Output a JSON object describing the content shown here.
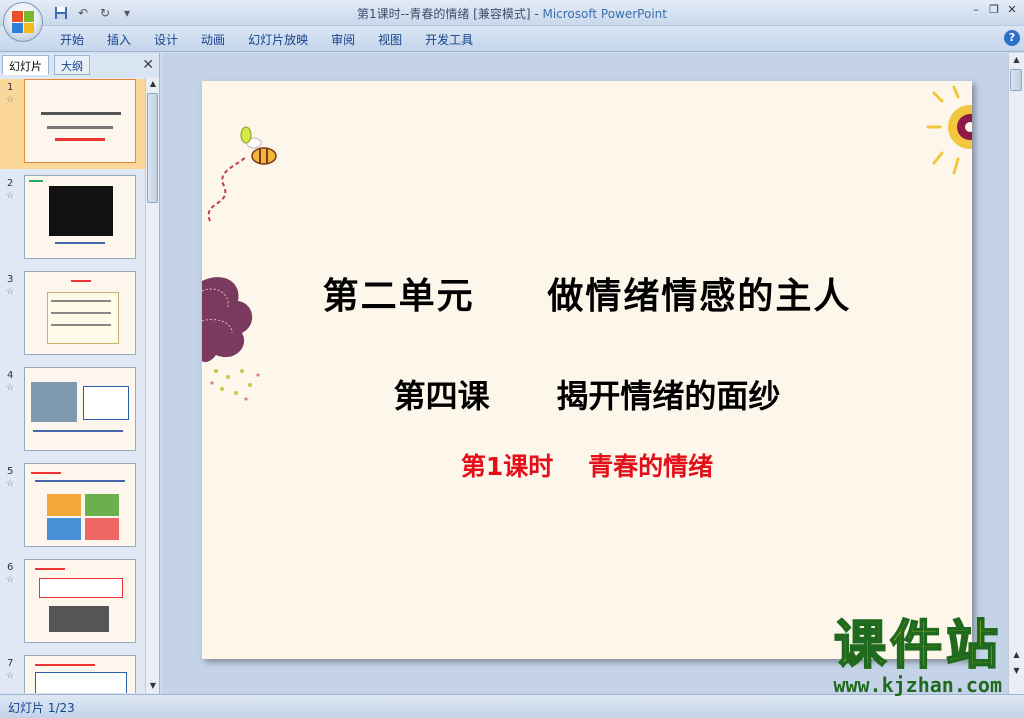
{
  "window": {
    "title_doc": "第1课时--青春的情绪 [兼容模式] - ",
    "title_app": "Microsoft PowerPoint"
  },
  "ribbon": {
    "tabs": [
      "开始",
      "插入",
      "设计",
      "动画",
      "幻灯片放映",
      "审阅",
      "视图",
      "开发工具"
    ]
  },
  "pane": {
    "tab_slides": "幻灯片",
    "tab_outline": "大纲",
    "close": "✕"
  },
  "thumbnails": [
    {
      "num": "1",
      "selected": true
    },
    {
      "num": "2"
    },
    {
      "num": "3"
    },
    {
      "num": "4"
    },
    {
      "num": "5"
    },
    {
      "num": "6"
    },
    {
      "num": "7"
    }
  ],
  "slide": {
    "title": "第二单元     做情绪情感的主人",
    "subtitle": "第四课      揭开情绪的面纱",
    "lesson": "第1课时    青春的情绪"
  },
  "status": {
    "slide_indicator": "幻灯片 1/23"
  },
  "watermark": {
    "cn": "课件站",
    "url": "www.kjzhan.com"
  },
  "colors": {
    "slide_bg": "#fdf6ea",
    "accent_red": "#e3101b",
    "watermark_yellow": "#f4ec10",
    "watermark_green": "#1f6a1f"
  }
}
